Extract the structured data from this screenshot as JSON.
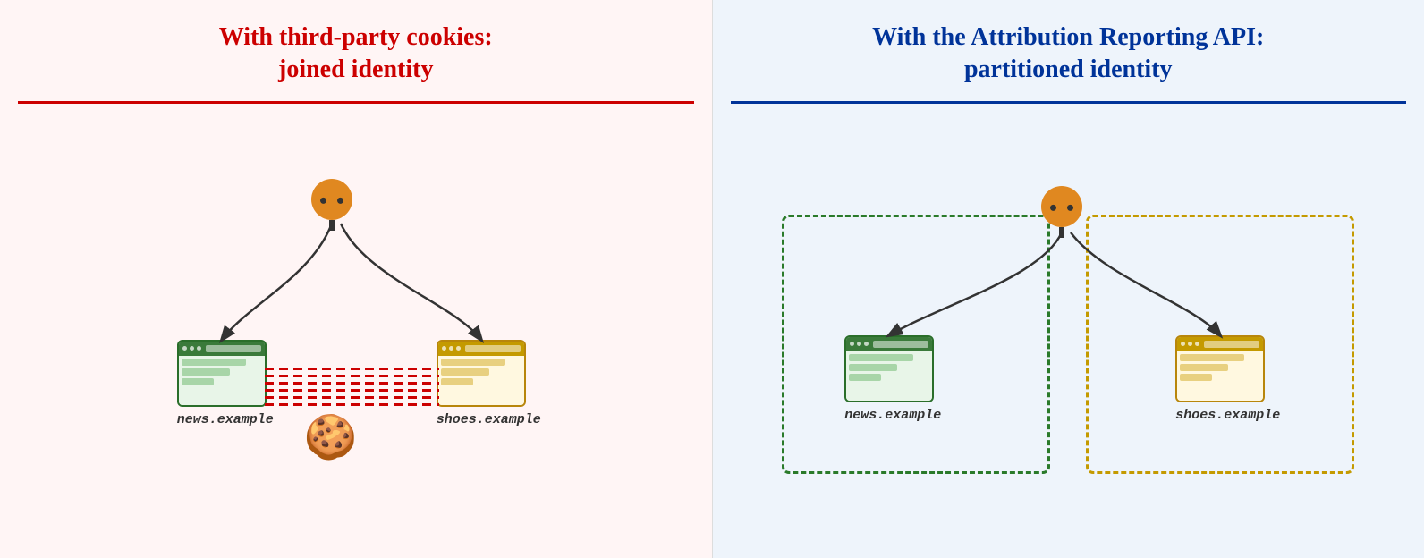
{
  "left": {
    "title_line1": "With third-party cookies:",
    "title_line2": "joined identity",
    "title_color": "title-red",
    "divider_color": "divider-red",
    "site1_label": "news.example",
    "site2_label": "shoes.example"
  },
  "right": {
    "title_line1": "With the Attribution Reporting API:",
    "title_line2": "partitioned identity",
    "title_color": "title-blue",
    "divider_color": "divider-blue",
    "site1_label": "news.example",
    "site2_label": "shoes.example"
  }
}
